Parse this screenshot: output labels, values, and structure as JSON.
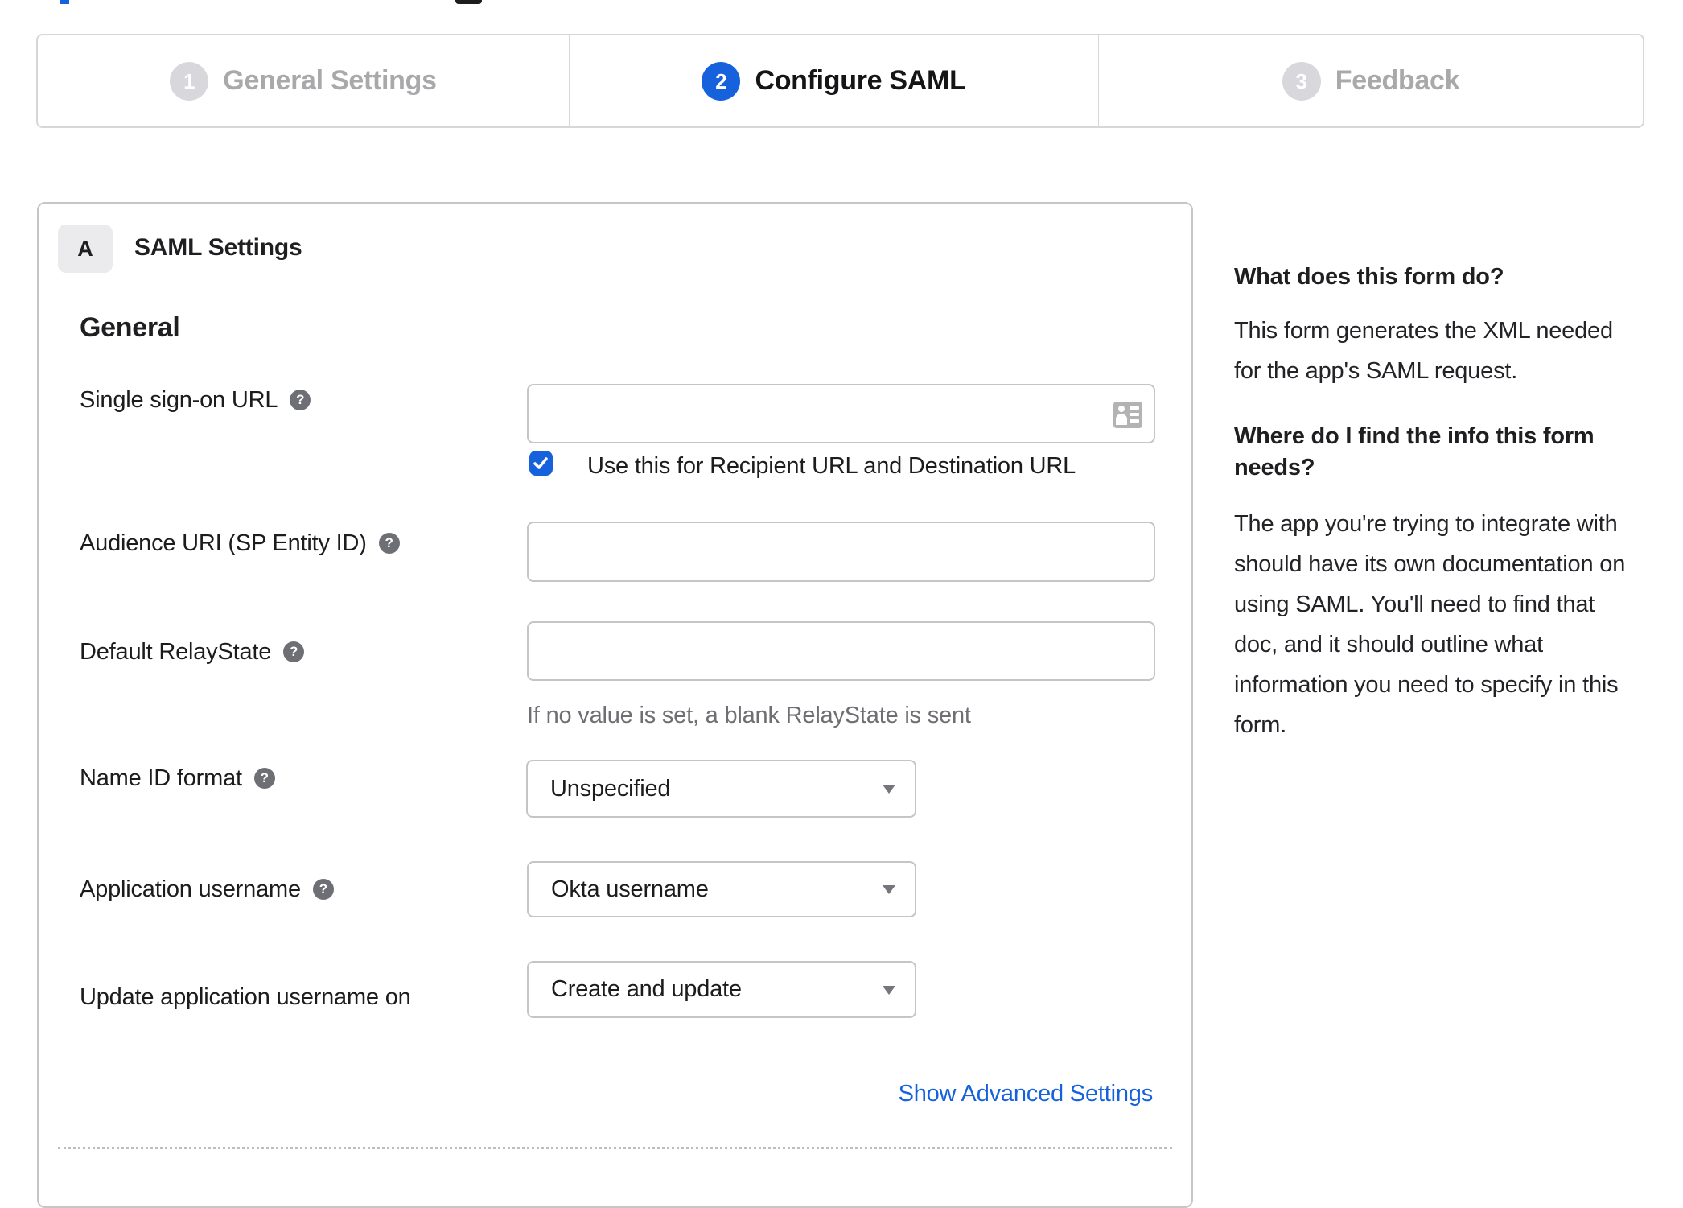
{
  "top_fragments": {
    "blue_fragment_color": "#1662dd",
    "dark_fragment_color": "#1d1d1f"
  },
  "stepper": {
    "steps": [
      {
        "number": "1",
        "label": "General Settings",
        "state": "previous"
      },
      {
        "number": "2",
        "label": "Configure SAML",
        "state": "active"
      },
      {
        "number": "3",
        "label": "Feedback",
        "state": "upcoming"
      }
    ],
    "active_color": "#1662dd",
    "inactive_circle_color": "#d8d8dc"
  },
  "panel": {
    "section_badge": "A",
    "title": "SAML Settings",
    "section_heading": "General",
    "rows": [
      {
        "label": "Single sign-on URL",
        "has_help": true,
        "control": "text-input",
        "value": ""
      },
      {
        "label": "Audience URI (SP Entity ID)",
        "has_help": true,
        "control": "text-input",
        "value": ""
      },
      {
        "label": "Default RelayState",
        "has_help": true,
        "control": "text-input",
        "value": "",
        "hint": "If no value is set, a blank RelayState is sent"
      },
      {
        "label": "Name ID format",
        "has_help": true,
        "control": "select",
        "value": "Unspecified"
      },
      {
        "label": "Application username",
        "has_help": true,
        "control": "select",
        "value": "Okta username"
      },
      {
        "label": "Update application username on",
        "has_help": false,
        "control": "select",
        "value": "Create and update"
      }
    ],
    "checkbox": {
      "checked": true,
      "label": "Use this for Recipient URL and Destination URL"
    },
    "advanced_link": "Show Advanced Settings"
  },
  "sidebar": {
    "heading1": "What does this form do?",
    "body1_lines": [
      "This form generates the XML needed",
      "for the app's SAML request."
    ],
    "heading2_lines": [
      "Where do I find the info this form",
      "needs?"
    ],
    "body2_lines": [
      "The app you're trying to integrate with",
      "should have its own documentation on",
      "using SAML. You'll need to find that",
      "doc, and it should outline what",
      "information you need to specify in this",
      "form."
    ]
  },
  "colors": {
    "accent_blue": "#1662dd",
    "panel_border": "#c6c6c6",
    "input_border": "#c5c5c5",
    "stepper_border": "#d7d7d7",
    "muted_text": "#a9a8ab",
    "help_icon_bg": "#6e6f75",
    "hint_text": "#6e6e73"
  }
}
